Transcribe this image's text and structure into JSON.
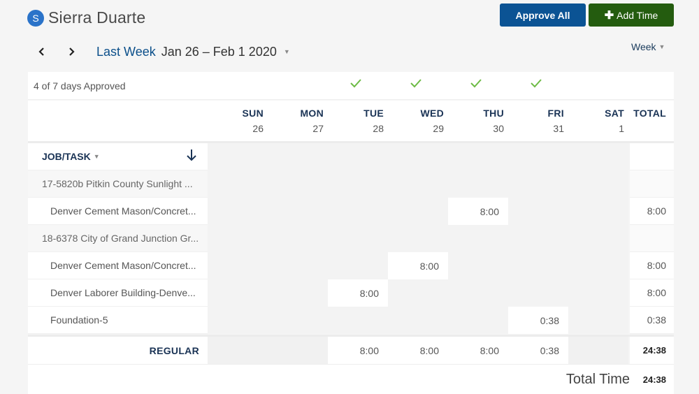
{
  "user": {
    "initial": "S",
    "name": "Sierra Duarte",
    "avatar_color": "#2a73c9"
  },
  "toolbar": {
    "approve_all_label": "Approve All",
    "add_time_label": "Add Time",
    "approve_color": "#0b5394",
    "add_color": "#245c0f"
  },
  "nav": {
    "prev_icon": "chevron-left-icon",
    "next_icon": "chevron-right-icon",
    "period_label": "Last Week",
    "date_range": "Jan 26 – Feb 1 2020",
    "view_label": "Week"
  },
  "approval": {
    "summary": "4 of 7 days Approved",
    "approved_days": [
      false,
      false,
      true,
      true,
      true,
      true,
      false
    ],
    "check_color": "#6dbb45"
  },
  "days": [
    {
      "name": "SUN",
      "date": "26"
    },
    {
      "name": "MON",
      "date": "27"
    },
    {
      "name": "TUE",
      "date": "28"
    },
    {
      "name": "WED",
      "date": "29"
    },
    {
      "name": "THU",
      "date": "30"
    },
    {
      "name": "FRI",
      "date": "31"
    },
    {
      "name": "SAT",
      "date": "1"
    }
  ],
  "total_header": "TOTAL",
  "table": {
    "column_header": "JOB/TASK",
    "rows": [
      {
        "type": "job",
        "label": "17-5820b Pitkin County Sunlight ...",
        "hours": [
          "",
          "",
          "",
          "",
          "",
          "",
          ""
        ],
        "total": ""
      },
      {
        "type": "task",
        "label": "Denver Cement Mason/Concret...",
        "hours": [
          "",
          "",
          "",
          "",
          "8:00",
          "",
          ""
        ],
        "total": "8:00"
      },
      {
        "type": "job",
        "label": "18-6378 City of Grand Junction Gr...",
        "hours": [
          "",
          "",
          "",
          "",
          "",
          "",
          ""
        ],
        "total": ""
      },
      {
        "type": "task",
        "label": "Denver Cement Mason/Concret...",
        "hours": [
          "",
          "",
          "",
          "8:00",
          "",
          "",
          ""
        ],
        "total": "8:00"
      },
      {
        "type": "task",
        "label": "Denver Laborer Building-Denve...",
        "hours": [
          "",
          "",
          "8:00",
          "",
          "",
          "",
          ""
        ],
        "total": "8:00"
      },
      {
        "type": "task",
        "label": "Foundation-5",
        "hours": [
          "",
          "",
          "",
          "",
          "",
          "0:38",
          ""
        ],
        "total": "0:38"
      }
    ],
    "regular": {
      "label": "REGULAR",
      "hours": [
        "",
        "",
        "8:00",
        "8:00",
        "8:00",
        "0:38",
        ""
      ],
      "total": "24:38"
    }
  },
  "summary": {
    "total_label": "Total Time",
    "total_value": "24:38"
  }
}
